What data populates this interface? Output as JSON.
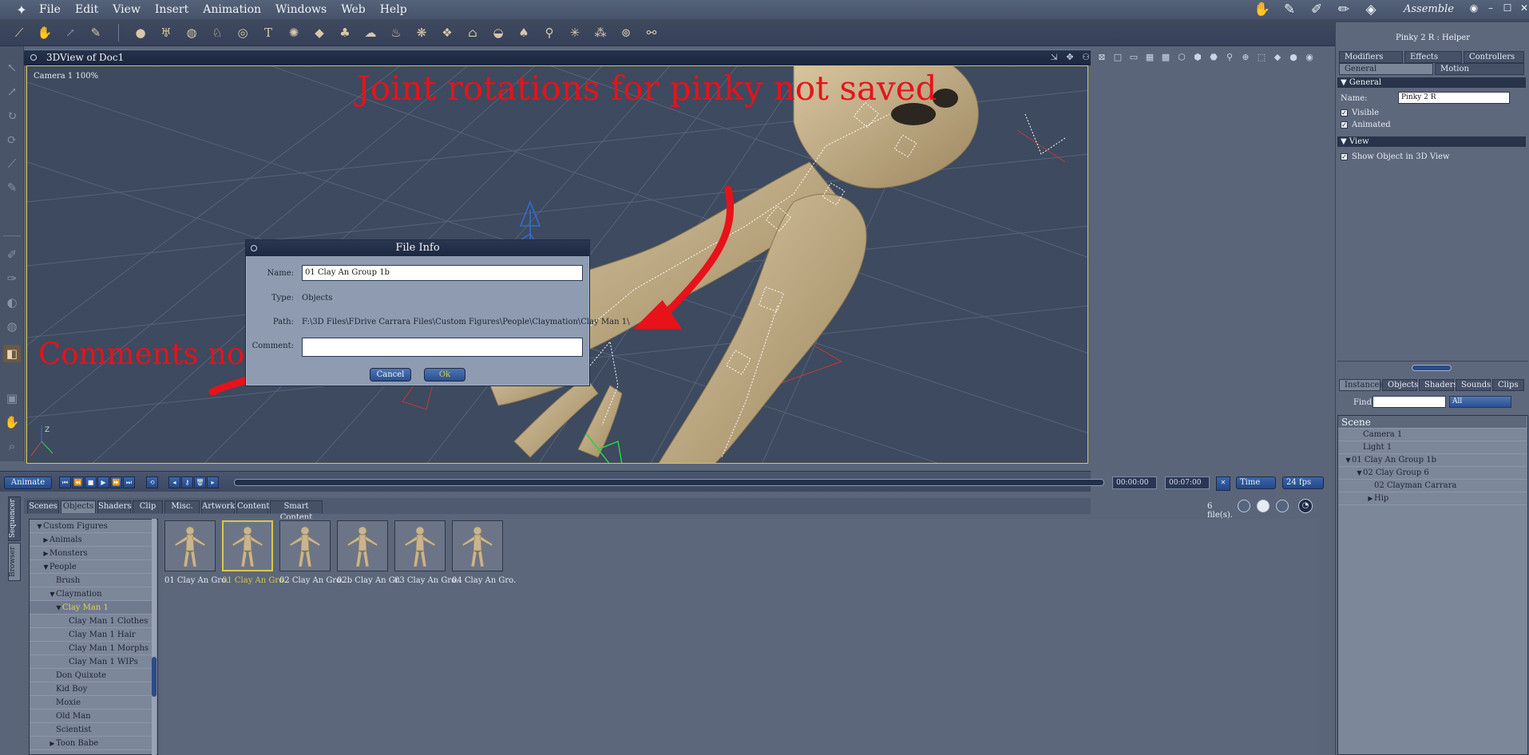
{
  "menubar": {
    "items": [
      "File",
      "Edit",
      "View",
      "Insert",
      "Animation",
      "Windows",
      "Web",
      "Help"
    ],
    "room_label": "Assemble"
  },
  "view": {
    "title": "3DView of Doc1",
    "camera_label": "Camera 1 100%"
  },
  "annotations": {
    "pinky": "Joint rotations for pinky not saved",
    "comments": "Comments not saved"
  },
  "dialog": {
    "title": "File Info",
    "name_label": "Name:",
    "name_value": "01 Clay An Group 1b",
    "type_label": "Type:",
    "type_value": "Objects",
    "path_label": "Path:",
    "path_value": "F:\\3D Files\\FDrive Carrara Files\\Custom Figures\\People\\Claymation\\Clay Man 1\\",
    "comment_label": "Comment:",
    "comment_value": "",
    "cancel": "Cancel",
    "ok": "Ok"
  },
  "timeline": {
    "animate": "Animate",
    "time_current": "00:00:00",
    "time_end": "00:07:00",
    "time_mode": "Time",
    "fps": "24 fps"
  },
  "browser": {
    "tabs": [
      "Scenes",
      "Objects",
      "Shaders",
      "Clip",
      "Misc.",
      "Artwork",
      "Content",
      "Smart Content"
    ],
    "active_tab": "Objects",
    "side_tabs": [
      "Sequencer",
      "Browser"
    ],
    "file_count": "6 file(s).",
    "tree": [
      {
        "label": "Custom Figures",
        "depth": 0,
        "tri": "▼",
        "selected": false
      },
      {
        "label": "Animals",
        "depth": 1,
        "tri": "▶",
        "selected": false
      },
      {
        "label": "Monsters",
        "depth": 1,
        "tri": "▶",
        "selected": false
      },
      {
        "label": "People",
        "depth": 1,
        "tri": "▼",
        "selected": false
      },
      {
        "label": "Brush",
        "depth": 2,
        "tri": "",
        "selected": false
      },
      {
        "label": "Claymation",
        "depth": 2,
        "tri": "▼",
        "selected": false
      },
      {
        "label": "Clay Man 1",
        "depth": 3,
        "tri": "▼",
        "selected": true
      },
      {
        "label": "Clay Man 1 Clothes",
        "depth": 4,
        "tri": "",
        "selected": false
      },
      {
        "label": "Clay Man 1 Hair",
        "depth": 4,
        "tri": "",
        "selected": false
      },
      {
        "label": "Clay Man 1 Morphs",
        "depth": 4,
        "tri": "",
        "selected": false
      },
      {
        "label": "Clay Man 1 WIPs",
        "depth": 4,
        "tri": "",
        "selected": false
      },
      {
        "label": "Don Quixote",
        "depth": 2,
        "tri": "",
        "selected": false
      },
      {
        "label": "Kid Boy",
        "depth": 2,
        "tri": "",
        "selected": false
      },
      {
        "label": "Moxie",
        "depth": 2,
        "tri": "",
        "selected": false
      },
      {
        "label": "Old Man",
        "depth": 2,
        "tri": "",
        "selected": false
      },
      {
        "label": "Scientist",
        "depth": 2,
        "tri": "",
        "selected": false
      },
      {
        "label": "Toon Babe",
        "depth": 2,
        "tri": "▶",
        "selected": false
      }
    ],
    "files": [
      {
        "label": "01 Clay An Gro.",
        "selected": false
      },
      {
        "label": "01 Clay An Gro.",
        "selected": true
      },
      {
        "label": "02 Clay An Gro.",
        "selected": false
      },
      {
        "label": "02b Clay An Gr.",
        "selected": false
      },
      {
        "label": "03 Clay An Gro.",
        "selected": false
      },
      {
        "label": "04 Clay An Gro.",
        "selected": false
      }
    ]
  },
  "properties": {
    "header": "Pinky 2 R : Helper",
    "tabs_row1": [
      "Modifiers",
      "Effects",
      "Controllers"
    ],
    "tabs_row2": [
      "General",
      "Motion"
    ],
    "section_general": "General",
    "name_label": "Name:",
    "name_value": "Pinky 2 R",
    "visible_label": "Visible",
    "animated_label": "Animated",
    "section_view": "View",
    "show_object_label": "Show Object in 3D View"
  },
  "instances": {
    "tabs": [
      "Instances",
      "Objects",
      "Shaders",
      "Sounds",
      "Clips"
    ],
    "find_label": "Find:",
    "find_value": "",
    "filter_value": "All",
    "scene_title": "Scene",
    "rows": [
      {
        "label": "Camera 1",
        "depth": 1,
        "tri": ""
      },
      {
        "label": "Light 1",
        "depth": 1,
        "tri": ""
      },
      {
        "label": "01 Clay An Group 1b",
        "depth": 0,
        "tri": "▼"
      },
      {
        "label": "02 Clay Group 6",
        "depth": 1,
        "tri": "▼"
      },
      {
        "label": "02 Clayman Carrara",
        "depth": 2,
        "tri": ""
      },
      {
        "label": "Hip",
        "depth": 2,
        "tri": "▶"
      }
    ]
  },
  "colors": {
    "annotation": "#e8121a",
    "accent_blue": "#2b4f8e",
    "selection_yellow": "#d8c84a",
    "figure_skin": "#c9b48e"
  }
}
